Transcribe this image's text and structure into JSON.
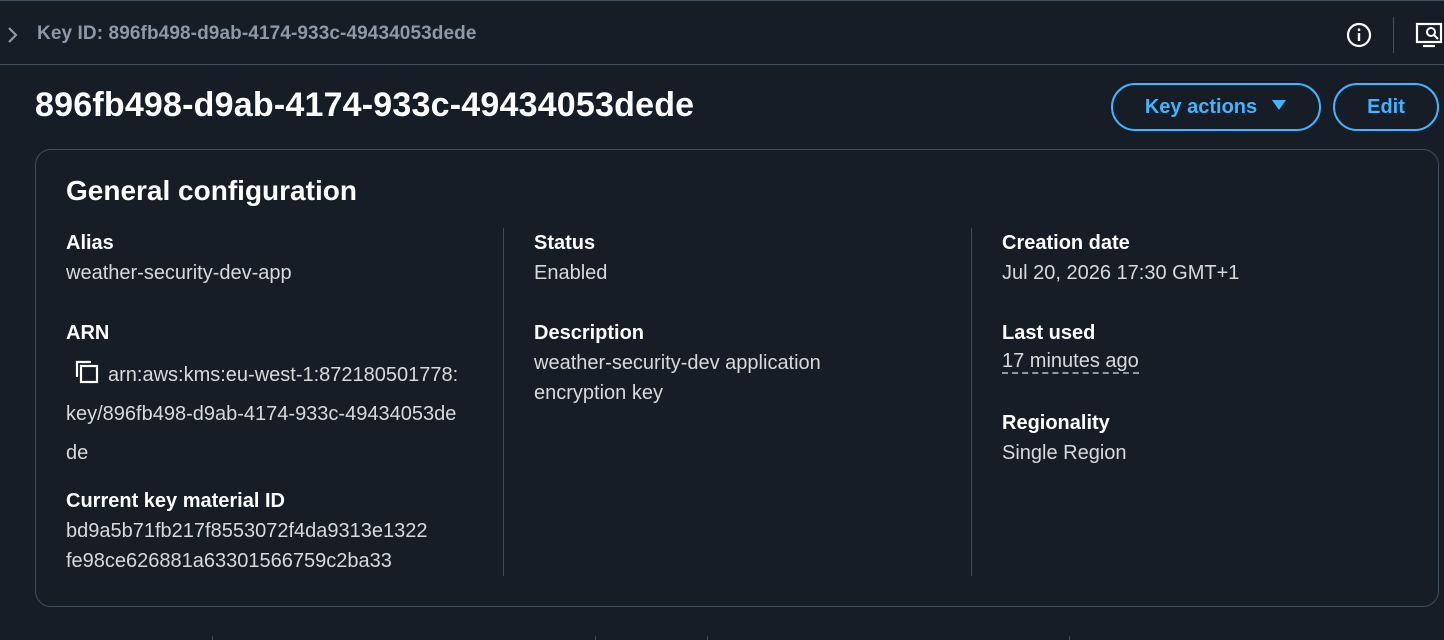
{
  "breadcrumb": {
    "label": "Key ID: 896fb498-d9ab-4174-933c-49434053dede"
  },
  "header": {
    "title": "896fb498-d9ab-4174-933c-49434053dede",
    "key_actions_label": "Key actions",
    "edit_label": "Edit"
  },
  "general_configuration": {
    "title": "General configuration",
    "alias": {
      "label": "Alias",
      "value": "weather-security-dev-app"
    },
    "arn": {
      "label": "ARN",
      "value": "arn:aws:kms:eu-west-1:872180501778:key/896fb498-d9ab-4174-933c-49434053dede"
    },
    "current_key_material": {
      "label": "Current key material ID",
      "line1": "bd9a5b71fb217f8553072f4da9313e1322",
      "line2": "fe98ce626881a63301566759c2ba33"
    },
    "status": {
      "label": "Status",
      "value": "Enabled"
    },
    "description": {
      "label": "Description",
      "line1": "weather-security-dev application",
      "line2": "encryption key"
    },
    "creation_date": {
      "label": "Creation date",
      "value": "Jul 20, 2026 17:30 GMT+1"
    },
    "last_used": {
      "label": "Last used",
      "value": "17 minutes ago"
    },
    "regionality": {
      "label": "Regionality",
      "value": "Single Region"
    }
  },
  "icons": {
    "breadcrumb_toggle": "chevron-right-icon",
    "info": "info-icon",
    "screen": "screen-search-icon",
    "copy": "copy-icon",
    "dropdown": "caret-down-icon"
  },
  "colors": {
    "background": "#161d26",
    "accent": "#42b4ff",
    "border": "#414d5c",
    "muted": "#8d99a8"
  }
}
